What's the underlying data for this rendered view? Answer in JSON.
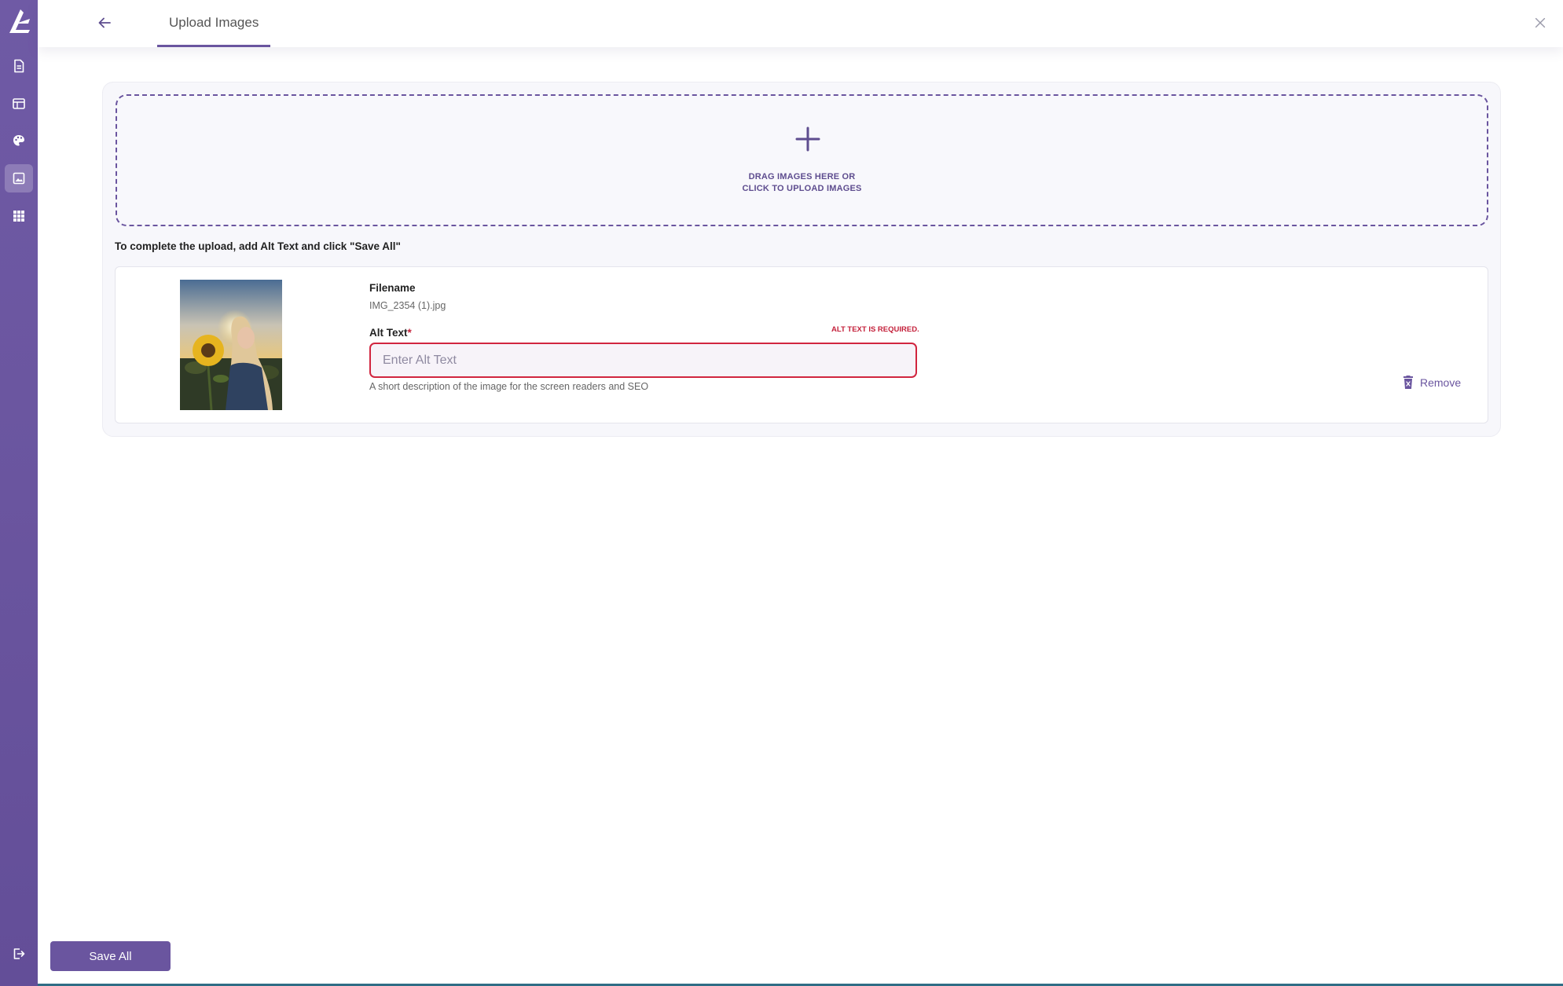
{
  "colors": {
    "accent": "#6a559f",
    "sidebar": "#6a559f",
    "error": "#c4213b",
    "text": "#222222",
    "muted": "#666666"
  },
  "sidebar": {
    "logo_icon": "brand-logo-icon",
    "items": [
      {
        "icon": "document-icon",
        "active": false
      },
      {
        "icon": "layout-icon",
        "active": false
      },
      {
        "icon": "palette-icon",
        "active": false
      },
      {
        "icon": "image-icon",
        "active": true
      },
      {
        "icon": "grid-apps-icon",
        "active": false
      }
    ],
    "logout_icon": "logout-icon"
  },
  "header": {
    "back_icon": "arrow-left-icon",
    "tab_label": "Upload Images",
    "close_icon": "close-icon"
  },
  "dropzone": {
    "icon": "plus-icon",
    "line1": "DRAG IMAGES HERE OR",
    "line2": "CLICK TO UPLOAD IMAGES"
  },
  "instruction": "To complete the upload, add Alt Text and click \"Save All\"",
  "image_item": {
    "filename_label": "Filename",
    "filename": "IMG_2354 (1).jpg",
    "alt_label": "Alt Text",
    "required_mark": "*",
    "alt_error": "ALT TEXT IS REQUIRED.",
    "alt_value": "",
    "alt_placeholder": "Enter Alt Text",
    "hint": "A short description of the image for the screen readers and SEO",
    "remove_label": "Remove",
    "remove_icon": "trash-icon"
  },
  "footer": {
    "save_label": "Save All"
  }
}
